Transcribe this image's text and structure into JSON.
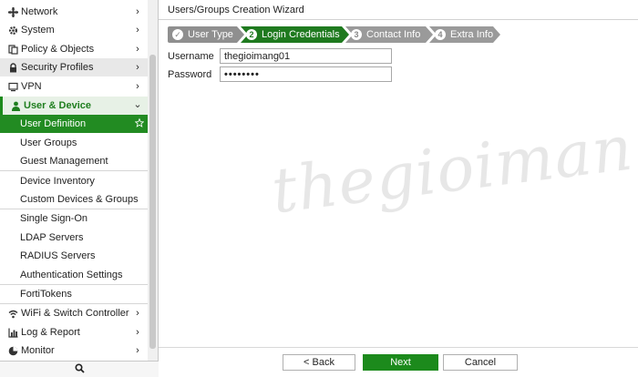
{
  "sidebar": {
    "items": [
      {
        "label": "Network",
        "icon": "network-icon",
        "chevron": "›"
      },
      {
        "label": "System",
        "icon": "gear-icon",
        "chevron": "›"
      },
      {
        "label": "Policy & Objects",
        "icon": "policy-icon",
        "chevron": "›"
      },
      {
        "label": "Security Profiles",
        "icon": "lock-icon",
        "chevron": "›"
      },
      {
        "label": "VPN",
        "icon": "monitor-icon",
        "chevron": "›"
      },
      {
        "label": "User & Device",
        "icon": "user-icon",
        "chevron": "⌄"
      },
      {
        "label": "User Definition",
        "icon": "star-icon"
      },
      {
        "label": "User Groups"
      },
      {
        "label": "Guest Management"
      },
      {
        "label": "Device Inventory"
      },
      {
        "label": "Custom Devices & Groups"
      },
      {
        "label": "Single Sign-On"
      },
      {
        "label": "LDAP Servers"
      },
      {
        "label": "RADIUS Servers"
      },
      {
        "label": "Authentication Settings"
      },
      {
        "label": "FortiTokens"
      },
      {
        "label": "WiFi & Switch Controller",
        "icon": "wifi-icon",
        "chevron": "›"
      },
      {
        "label": "Log & Report",
        "icon": "chart-icon",
        "chevron": "›"
      },
      {
        "label": "Monitor",
        "icon": "pie-icon",
        "chevron": "›"
      }
    ],
    "search_icon": "search-icon"
  },
  "main": {
    "title": "Users/Groups Creation Wizard",
    "steps": [
      {
        "label": "User Type",
        "marker": "✓"
      },
      {
        "label": "Login Credentials",
        "marker": "2"
      },
      {
        "label": "Contact Info",
        "marker": "3"
      },
      {
        "label": "Extra Info",
        "marker": "4"
      }
    ],
    "form": {
      "username_label": "Username",
      "username_value": "thegioimang01",
      "password_label": "Password",
      "password_value": "••••••••"
    },
    "watermark": "thegioimang.vn",
    "footer": {
      "back_label": "< Back",
      "next_label": "Next",
      "cancel_label": "Cancel"
    }
  },
  "colors": {
    "accent_green": "#228b22",
    "step_done": "#8f8f8f",
    "step_current": "#1f7a1f",
    "step_pending": "#9a9a9a"
  }
}
